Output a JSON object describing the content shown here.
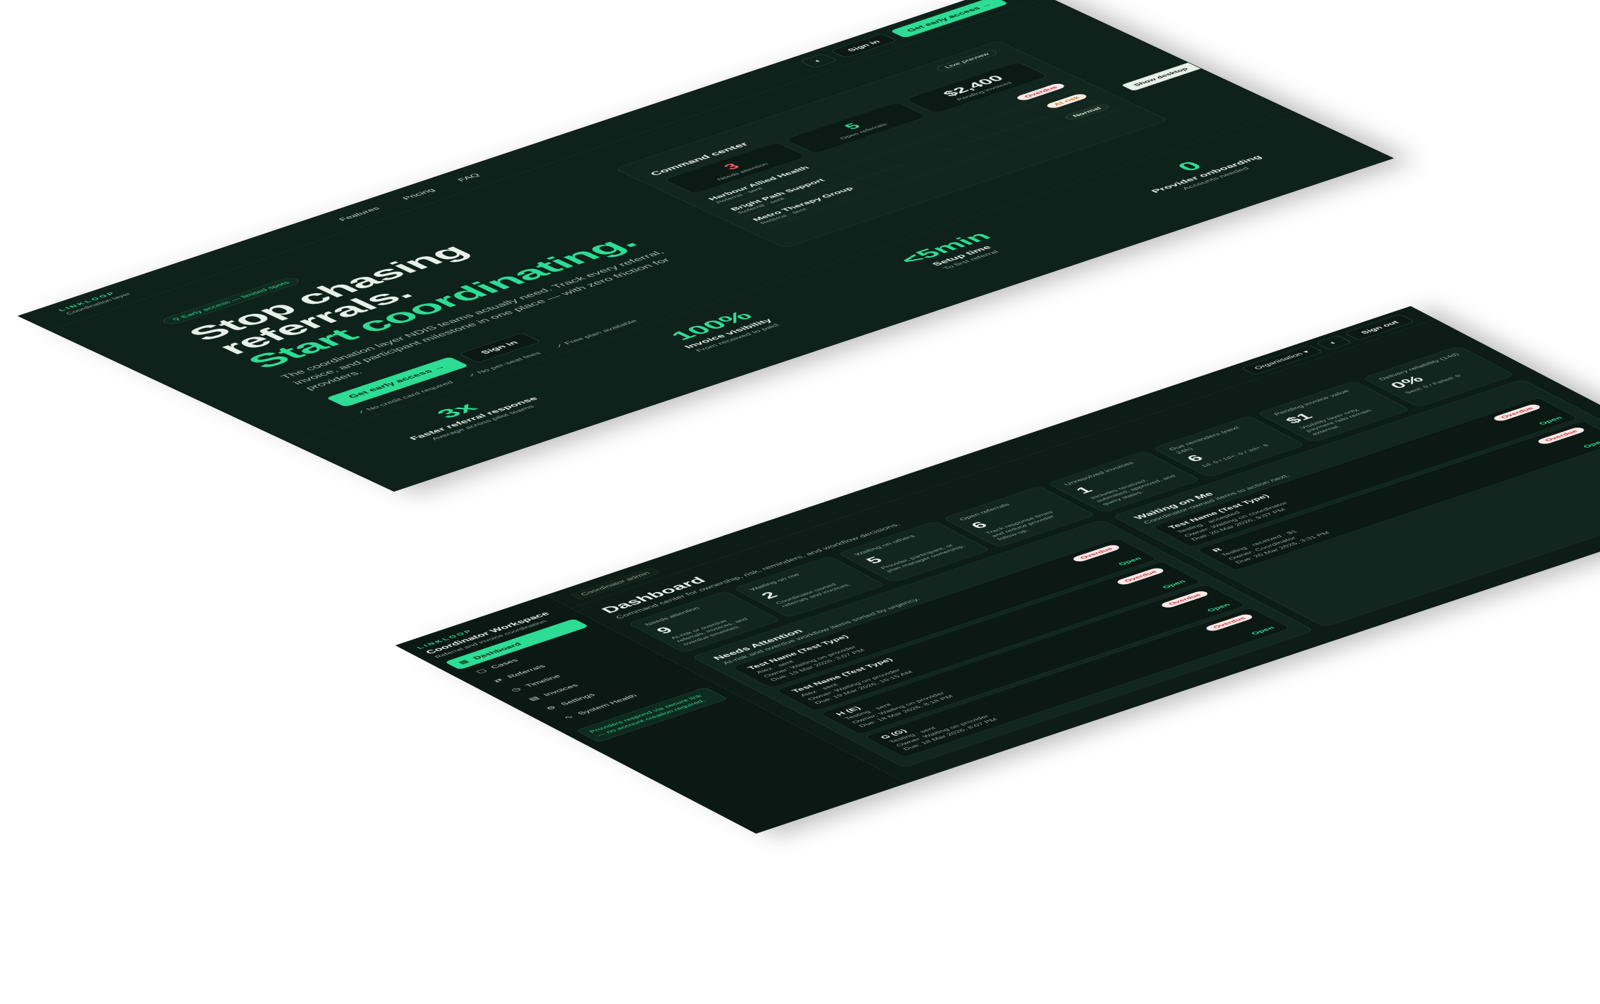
{
  "landing": {
    "brand": "LINKLOOP",
    "brand_sub": "Coordination layer",
    "nav": [
      "Features",
      "Pricing",
      "FAQ"
    ],
    "sign_in": "Sign in",
    "get_access": "Get early access",
    "badge": "Early access — limited spots",
    "h1_line1": "Stop chasing",
    "h1_line2": "referrals.",
    "h1_accent": "Start coordinating.",
    "lead": "The coordination layer NDIS teams actually need. Track every referral, invoice, and participant milestone in one place — with zero friction for providers.",
    "checks": [
      "No credit card required",
      "No per-seat fees",
      "Free plan available"
    ],
    "preview": {
      "live": "Live preview",
      "title": "Command center",
      "stats": [
        {
          "value": "3",
          "label": "Needs attention",
          "color": "#ff5a6a"
        },
        {
          "value": "5",
          "label": "Open referrals",
          "color": "#2ddc95"
        },
        {
          "value": "$2,400",
          "label": "Pending invoices",
          "color": "#ffffff"
        }
      ],
      "providers": [
        {
          "name": "Harbour Allied Health",
          "status": "Referral · sent",
          "tag": "Overdue",
          "kind": "overdue"
        },
        {
          "name": "Bright Path Support",
          "status": "Referral · sent",
          "tag": "At risk",
          "kind": "atrisk"
        },
        {
          "name": "Metro Therapy Group",
          "status": "Referral · sent",
          "tag": "Normal",
          "kind": "normal"
        }
      ]
    },
    "stats": [
      {
        "value": "3x",
        "label": "Faster referral response",
        "desc": "Average across pilot teams"
      },
      {
        "value": "100%",
        "label": "Invoice visibility",
        "desc": "From received to paid"
      },
      {
        "value": "<5min",
        "label": "Setup time",
        "desc": "To first referral"
      },
      {
        "value": "0",
        "label": "Provider onboarding",
        "desc": "Accounts needed"
      }
    ],
    "show_desktop": "Show desktop"
  },
  "dashboard": {
    "brand": "LINKLOOP",
    "workspace_title": "Coordinator Workspace",
    "workspace_sub": "Referral and invoice coordination",
    "nav": [
      {
        "label": "Dashboard",
        "icon": "▦",
        "active": true
      },
      {
        "label": "Cases",
        "icon": "▢"
      },
      {
        "label": "Referrals",
        "icon": "⇄"
      },
      {
        "label": "Timeline",
        "icon": "◷"
      },
      {
        "label": "Invoices",
        "icon": "▤"
      },
      {
        "label": "Settings",
        "icon": "⚙"
      },
      {
        "label": "System Health",
        "icon": "∿"
      }
    ],
    "side_note": "Providers respond via secure link — no account creation required.",
    "role": "Coordinator admin",
    "org_select": "Organisation",
    "sign_out": "Sign out",
    "title": "Dashboard",
    "subtitle": "Command center for ownership, risk, reminders, and workflow decisions.",
    "kpis": [
      {
        "label": "Needs attention",
        "value": "9",
        "desc": "At-risk or overdue referrals, invoices, and overdue timelines."
      },
      {
        "label": "Waiting on me",
        "value": "2",
        "desc": "Coordinator-owned referrals and invoices."
      },
      {
        "label": "Waiting on others",
        "value": "5",
        "desc": "Provider, participant, or plan manager ownership."
      },
      {
        "label": "Open referrals",
        "value": "6",
        "desc": "Track response times and reduce provider follow-up."
      },
      {
        "label": "Unresolved invoices",
        "value": "1",
        "desc": "Includes received, submitted, approved, and query states."
      },
      {
        "label": "Due reminders (next 24h)",
        "value": "6",
        "desc": "1d: 0 / 1d+: 0 / 3d+: 6"
      },
      {
        "label": "Pending invoice value",
        "value": "$1",
        "desc": "Visibility layer only, payment rails remain external."
      },
      {
        "label": "Delivery reliability (14d)",
        "value": "0%",
        "desc": "Sent: 0 / Failed: 0"
      }
    ],
    "needs_attention": {
      "title": "Needs Attention",
      "subtitle": "At-risk and overdue workflow items sorted by urgency.",
      "items": [
        {
          "name": "Test Name (Test Type)",
          "line1": "Alex · sent",
          "line2": "Owner: Waiting on provider",
          "line3": "Due: 19 Mar 2026, 3:07 PM",
          "tag": "Overdue"
        },
        {
          "name": "Test Name (Test Type)",
          "line1": "Alex · sent",
          "line2": "Owner: Waiting on provider",
          "line3": "Due: 19 Mar 2026, 10:15 AM",
          "tag": "Overdue"
        },
        {
          "name": "H (E)",
          "line1": "Testing · sent",
          "line2": "Owner: Waiting on provider",
          "line3": "Due: 18 Mar 2026, 8:18 PM",
          "tag": "Overdue"
        },
        {
          "name": "G (G)",
          "line1": "Testing · sent",
          "line2": "Owner: Waiting on provider",
          "line3": "Due: 18 Mar 2026, 8:07 PM",
          "tag": "Overdue"
        }
      ]
    },
    "waiting_on_me": {
      "title": "Waiting on Me",
      "subtitle": "Coordinator-owned items to action next.",
      "items": [
        {
          "name": "Test Name (Test Type)",
          "line1": "Testing · accepted",
          "line2": "Owner: Waiting on coordinator",
          "line3": "Due: 20 Mar 2026, 9:07 PM",
          "tag": "Overdue"
        },
        {
          "name": "R",
          "line1": "Testing · received · $1",
          "line2": "Owner: Coordinator",
          "line3": "Due: 20 Mar 2026, 3:31 PM",
          "tag": "Overdue"
        }
      ]
    },
    "open_label": "Open"
  }
}
